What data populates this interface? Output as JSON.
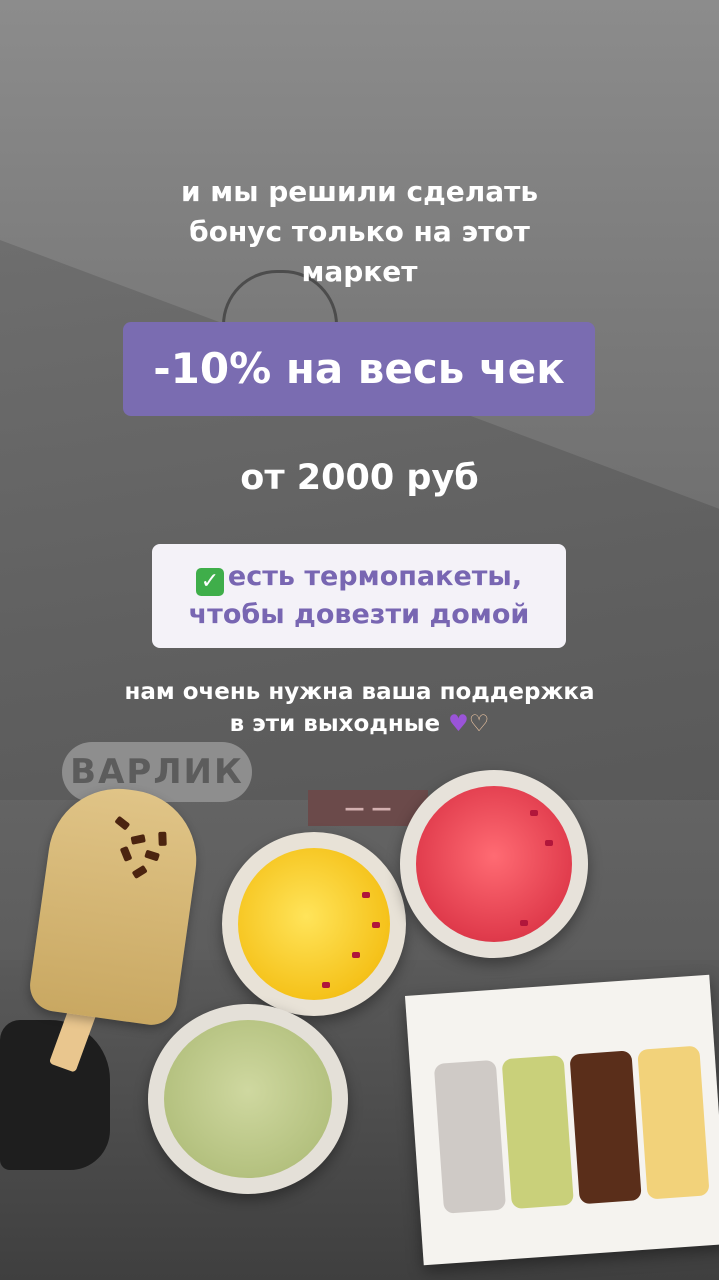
{
  "promo": {
    "intro_line1": "и мы решили сделать",
    "intro_line2": "бонус только на этот",
    "intro_line3": "маркет",
    "discount": "-10% на весь чек",
    "minimum": "от 2000 руб",
    "note_line1": "есть термопакеты,",
    "note_line2": "чтобы довезти домой",
    "support_line1": "нам очень нужна ваша поддержка",
    "support_line2": "в эти выходные",
    "check_icon": "✅",
    "heart_icon": "💜",
    "hands_icon": "🫶"
  },
  "background": {
    "sign_text": "ВАРЛИК",
    "colors": {
      "discount_bg": "#7a6cb1",
      "note_bg": "#f4f2f8",
      "note_text": "#7866b2"
    }
  }
}
